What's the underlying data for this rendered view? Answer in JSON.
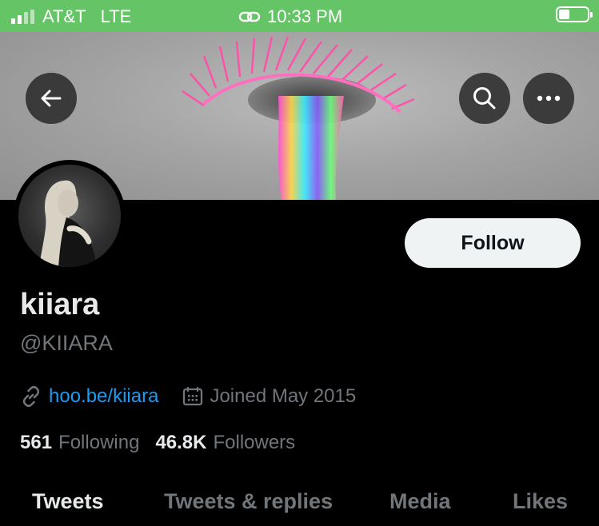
{
  "status_bar": {
    "carrier": "AT&T",
    "network": "LTE",
    "time": "10:33 PM",
    "color": "#65c466"
  },
  "header": {
    "back_icon": "arrow-left-icon",
    "search_icon": "search-icon",
    "more_icon": "more-icon"
  },
  "profile": {
    "name": "kiiara",
    "handle": "@KIIARA",
    "link": "hoo.be/kiiara",
    "joined": "Joined May 2015",
    "following_count": "561",
    "following_label": "Following",
    "followers_count": "46.8K",
    "followers_label": "Followers",
    "follow_label": "Follow"
  },
  "tabs": [
    {
      "label": "Tweets",
      "active": true
    },
    {
      "label": "Tweets & replies",
      "active": false
    },
    {
      "label": "Media",
      "active": false
    },
    {
      "label": "Likes",
      "active": false
    }
  ],
  "colors": {
    "background": "#000000",
    "link": "#1d9bf0",
    "secondary_text": "#71767b",
    "primary_text": "#e7e9ea",
    "follow_button": "#eff3f4"
  }
}
